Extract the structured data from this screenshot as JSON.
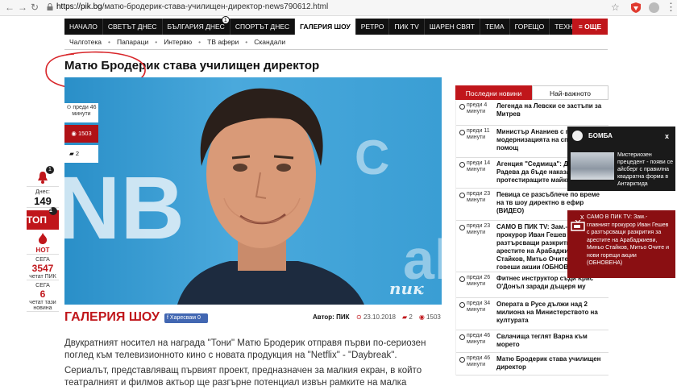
{
  "browser": {
    "url_domain": "https://pik.bg",
    "url_path": "/матю-бродерик-става-училищен-директор-news790612.html"
  },
  "nav": {
    "items": [
      "НАЧАЛО",
      "СВЕТЪТ ДНЕС",
      "БЪЛГАРИЯ ДНЕС",
      "СПОРТЪТ ДНЕС",
      "ГАЛЕРИЯ ШОУ",
      "РЕТРО",
      "ПИК TV",
      "ШАРЕН СВЯТ",
      "ТЕМА",
      "ГОРЕЩО",
      "ТЕХНОЛОГИИ"
    ],
    "badge": "1",
    "more": "≡ ОЩЕ"
  },
  "subnav": [
    "Чалготека",
    "Папараци",
    "Интервю",
    "ТВ афери",
    "Скандали"
  ],
  "article": {
    "title": "Матю Бродерик става училищен директор",
    "time_label": "преди 46 минути",
    "views": "1503",
    "comments": "2",
    "section": "ГАЛЕРИЯ ШОУ",
    "like": "Харесвам 0",
    "author_label": "Автор:",
    "author": "ПИК",
    "date": "23.10.2018",
    "comment_count": "2",
    "view_count": "1503",
    "watermark": "пик",
    "paragraphs": [
      "Двукратният носител на награда \"Тони\" Матю Бродерик отправя първи по-сериозен поглед към телевизионното кино с новата продукция на \"Netflix\" - \"Daybreak\".",
      "Сериалът, представляващ първият проект, предназначен за малкия екран, в който театралният и филмов актьор ще разгърне потенциал извън рамките на малка епизодична роля."
    ]
  },
  "left_rail": {
    "bell_badge": "1",
    "today_label": "Днес:",
    "today_value": "149",
    "top_label": "ТОП",
    "top_badge": "1",
    "hot_label": "HOT",
    "now_label": "СЕГА",
    "readers_value": "3547",
    "readers_label": "четат ПИК",
    "now_label2": "СЕГА",
    "news_readers_value": "6",
    "news_readers_label": "четат тази новина"
  },
  "news_panel": {
    "tab_latest": "Последни новини",
    "tab_important": "Най-важното",
    "items": [
      {
        "time": "преди 4 минути",
        "title": "Легенда на Левски се застъпи за Митрев"
      },
      {
        "time": "преди 11 минути",
        "title": "Министър Ананиев с програма за модернизацията на спешната помощ"
      },
      {
        "time": "преди 14 минути",
        "title": "Агенция \"Седмица\": Депутатът Радева да бъде наказана заради протестиращите майки"
      },
      {
        "time": "преди 23 минути",
        "title": "Певица се разсъблече по време на тв шоу директно в ефир (ВИДЕО)"
      },
      {
        "time": "преди 23 минути",
        "title": "САМО В ПИК TV: Зам.-главният прокурор Иван Гешев с разтърсващи разкрития за арестите на Арабаджиеви, Миньо Стайков, Митьо Очите и нови горещи акции (ОБНОВЕНА)"
      },
      {
        "time": "преди 26 минути",
        "title": "Фитнес инструктор съди Крис О'Донъл заради дъщеря му"
      },
      {
        "time": "преди 34 минути",
        "title": "Операта в Русе дължи над 2 милиона на Министерството на културата"
      },
      {
        "time": "преди 46 минути",
        "title": "Свлачища теглят Варна към морето"
      },
      {
        "time": "преди 46 минути",
        "title": "Матю Бродерик става училищен директор"
      }
    ]
  },
  "popup_bomb": {
    "label": "БОМБА",
    "close": "x",
    "text": "Мистериозен прецедент - появи се айсберг с правилна квадратна форма в Антарктида"
  },
  "popup_tv": {
    "close": "x",
    "text": "САМО В ПИК TV: Зам.-главният прокурор Иван Гешев с разтърсващи разкрития за арестите на Арабаджиеви, Миньо Стайков, Митьо Очите и нови горещи акции (ОБНОВЕНА)"
  },
  "colors": {
    "brand_red": "#c0161b",
    "nav_black": "#111111",
    "dark_red": "#8a0f12"
  }
}
